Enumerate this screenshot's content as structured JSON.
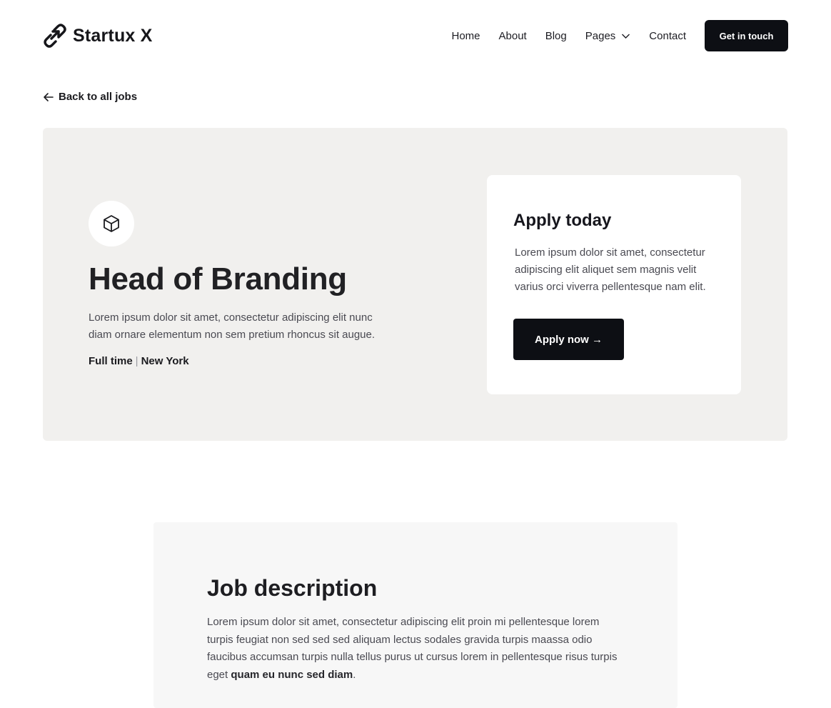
{
  "brand": {
    "name": "Startux X",
    "icon": "link-arrow-logo-icon"
  },
  "nav": {
    "items": [
      "Home",
      "About",
      "Blog",
      "Pages",
      "Contact"
    ],
    "cta": "Get in touch"
  },
  "back_link": "Back to all jobs",
  "job": {
    "icon": "cube-icon",
    "title": "Head of Branding",
    "description": "Lorem ipsum dolor sit amet, consectetur adipiscing elit nunc diam ornare elementum non sem pretium rhoncus sit augue.",
    "type": "Full time",
    "separator": "|",
    "location": "New York"
  },
  "apply": {
    "title": "Apply today",
    "text": "Lorem ipsum dolor sit amet, consectetur adipiscing elit aliquet sem magnis velit varius orci viverra pellentesque nam elit.",
    "button": "Apply now →"
  },
  "job_description": {
    "title": "Job description",
    "text": "Lorem ipsum dolor sit amet, consectetur adipiscing elit proin mi pellentesque  lorem turpis feugiat non sed sed sed aliquam lectus sodales gravida turpis maassa odio faucibus accumsan turpis nulla tellus purus ut   cursus lorem  in pellentesque risus turpis eget ",
    "bold": "quam eu nunc sed diam",
    "end": "."
  },
  "colors": {
    "dark": "#0d0f14",
    "hero_bg": "#f1f0ee",
    "section_bg": "#f7f7f7"
  }
}
